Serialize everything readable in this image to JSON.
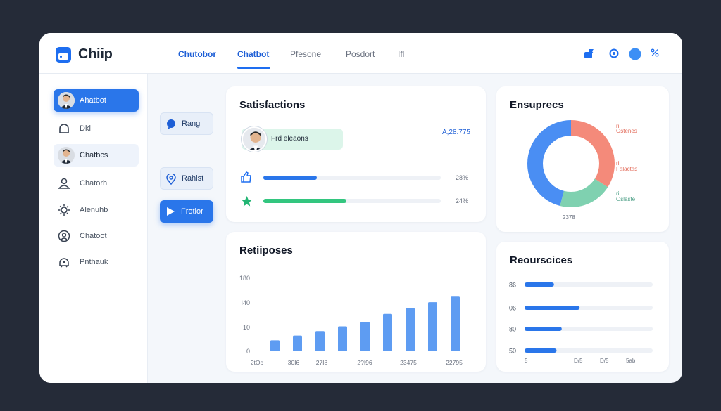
{
  "app": {
    "name": "Chiip"
  },
  "nav": [
    "Chutobor",
    "Chatbot",
    "Pfesone",
    "Posdort",
    "Ifl"
  ],
  "top_icons": [
    "flag-icon",
    "settings-dot-icon",
    "user-circle-icon",
    "percent-icon"
  ],
  "sidebar": {
    "items": [
      {
        "label": "Ahatbot",
        "icon": "avatar",
        "state": "active"
      },
      {
        "label": "Dkl",
        "icon": "user-outline-icon",
        "state": "normal"
      },
      {
        "label": "Chatbcs",
        "icon": "avatar",
        "state": "soft"
      },
      {
        "label": "Chatorh",
        "icon": "person-icon",
        "state": "normal"
      },
      {
        "label": "Alenuhb",
        "icon": "gear-icon",
        "state": "normal"
      },
      {
        "label": "Chatoot",
        "icon": "face-icon",
        "state": "normal"
      },
      {
        "label": "Pnthauk",
        "icon": "bot-icon",
        "state": "normal"
      }
    ]
  },
  "mid_buttons": [
    {
      "label": "Rang",
      "icon": "chat-bubble-icon"
    },
    {
      "label": "Rahist",
      "icon": "location-icon"
    },
    {
      "label": "Frotlor",
      "icon": "play-icon"
    }
  ],
  "satisfaction": {
    "title": "Satisfactions",
    "pill_label": "Frd eleaons",
    "value": "A,28.775",
    "bars": [
      {
        "icon": "thumbs-up-icon",
        "fraction": 0.3,
        "label": "28%",
        "color": "#2a76ea"
      },
      {
        "icon": "star-icon",
        "fraction": 0.47,
        "label": "24%",
        "color": "#33c67f"
      }
    ]
  },
  "donut": {
    "title": "Ensuprecs",
    "center_label": "2378",
    "labels": [
      {
        "a": "ri",
        "b": "Ostenes"
      },
      {
        "a": "ri",
        "b": "Falactas"
      },
      {
        "a": "ri",
        "b": "Oslaste"
      }
    ],
    "segments": [
      {
        "fraction": 0.34,
        "color": "#f48a7a"
      },
      {
        "fraction": 0.2,
        "color": "#7fd1b0"
      },
      {
        "fraction": 0.46,
        "color": "#4a8ef3"
      }
    ]
  },
  "responses": {
    "title": "Retiiposes",
    "y_ticks": [
      "0",
      "10",
      "I40",
      "180"
    ],
    "x_labels": [
      "2tOo",
      "30I6",
      "27I8",
      "2?I96",
      "23475",
      "22795"
    ]
  },
  "chart_data": {
    "type": "bar",
    "title": "Retiiposes",
    "ylim": [
      0,
      230
    ],
    "y_ticks": [
      "0",
      "10",
      "I40",
      "180"
    ],
    "x_tick_labels": [
      "2tOo",
      "30I6",
      "27I8",
      "2?I96",
      "23475",
      "22795"
    ],
    "values": [
      30,
      43,
      55,
      68,
      80,
      102,
      118,
      134,
      149
    ],
    "color": "#5e9cf2",
    "grid": false,
    "legend": "none"
  },
  "resources": {
    "title": "Reourscices",
    "rows": [
      {
        "label": "86",
        "fraction": 0.23
      },
      {
        "label": "06",
        "fraction": 0.43
      },
      {
        "label": "80",
        "fraction": 0.29
      },
      {
        "label": "50",
        "fraction": 0.25
      }
    ],
    "x_labels": [
      "5",
      "D/5",
      "D/5",
      "5ab"
    ]
  }
}
